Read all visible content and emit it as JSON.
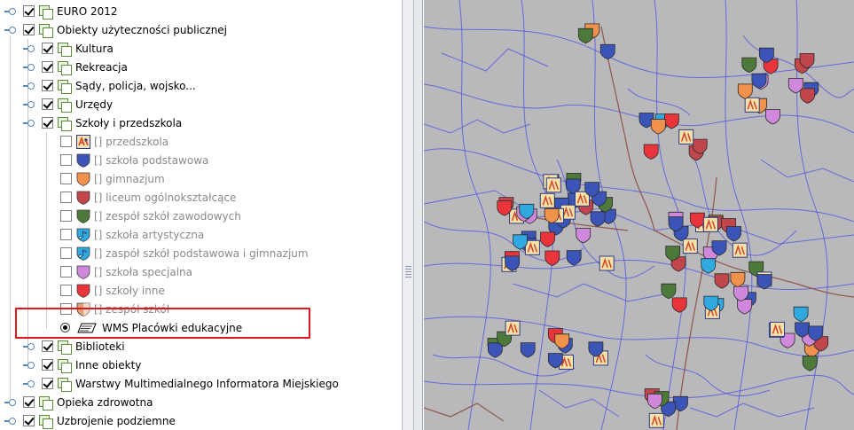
{
  "tree": {
    "rows": [
      {
        "label": "EURO 2012",
        "state": "checked",
        "kind": "group"
      },
      {
        "label": "Obiekty użyteczności publicznej",
        "state": "checked",
        "kind": "group"
      },
      {
        "label": "Kultura",
        "state": "checked",
        "kind": "group"
      },
      {
        "label": "Rekreacja",
        "state": "checked",
        "kind": "group"
      },
      {
        "label": "Sądy, policja, wojsko...",
        "state": "checked",
        "kind": "group"
      },
      {
        "label": "Urzędy",
        "state": "checked",
        "kind": "group"
      },
      {
        "label": "Szkoły i przedszkola",
        "state": "checked",
        "kind": "group"
      },
      {
        "label": "[] przedszkola",
        "state": "unchecked",
        "kind": "layer",
        "icon": "preschool-icon"
      },
      {
        "label": "[] szkoła podstawowa",
        "state": "unchecked",
        "kind": "layer",
        "icon": "shield-icon",
        "color": "#3b54b7"
      },
      {
        "label": "[] gimnazjum",
        "state": "unchecked",
        "kind": "layer",
        "icon": "shield-icon",
        "color": "#f0924c"
      },
      {
        "label": "[] liceum ogólnokształcące",
        "state": "unchecked",
        "kind": "layer",
        "icon": "shield-icon",
        "color": "#c0464c"
      },
      {
        "label": "[] zespół szkół zawodowych",
        "state": "unchecked",
        "kind": "layer",
        "icon": "shield-icon",
        "color": "#4d7a3a"
      },
      {
        "label": "[] szkoła artystyczna",
        "state": "unchecked",
        "kind": "layer",
        "icon": "music-shield-icon",
        "color": "#2fa9e0"
      },
      {
        "label": "[] zaspół szkół podstawowa i gimnazjum",
        "state": "unchecked",
        "kind": "layer",
        "icon": "music-shield-icon",
        "color": "#2fa9e0"
      },
      {
        "label": "[] szkoła specjalna",
        "state": "unchecked",
        "kind": "layer",
        "icon": "shield-icon",
        "color": "#cf88db"
      },
      {
        "label": "[] szkoły inne",
        "state": "unchecked",
        "kind": "layer",
        "icon": "shield-icon",
        "color": "#e8343a"
      },
      {
        "label": "[] zespół szkół",
        "state": "unchecked",
        "kind": "layer",
        "icon": "split-shield-icon",
        "color": "#e2a07a"
      },
      {
        "label": "WMS Placówki edukacyjne",
        "state": "selected",
        "kind": "wms"
      },
      {
        "label": "Biblioteki",
        "state": "checked",
        "kind": "group"
      },
      {
        "label": "Inne obiekty",
        "state": "checked",
        "kind": "group"
      },
      {
        "label": "Warstwy Multimedialnego Informatora Miejskiego",
        "state": "checked",
        "kind": "group"
      },
      {
        "label": "Opieka zdrowotna",
        "state": "checked",
        "kind": "group"
      },
      {
        "label": "Uzbrojenie podziemne",
        "state": "checked",
        "kind": "group"
      }
    ]
  },
  "colors": {
    "highlight": "#e0161c",
    "map_background": "#b9b9bc",
    "roads": "#4a4ee0",
    "main_roads": "#8a4b3c"
  }
}
